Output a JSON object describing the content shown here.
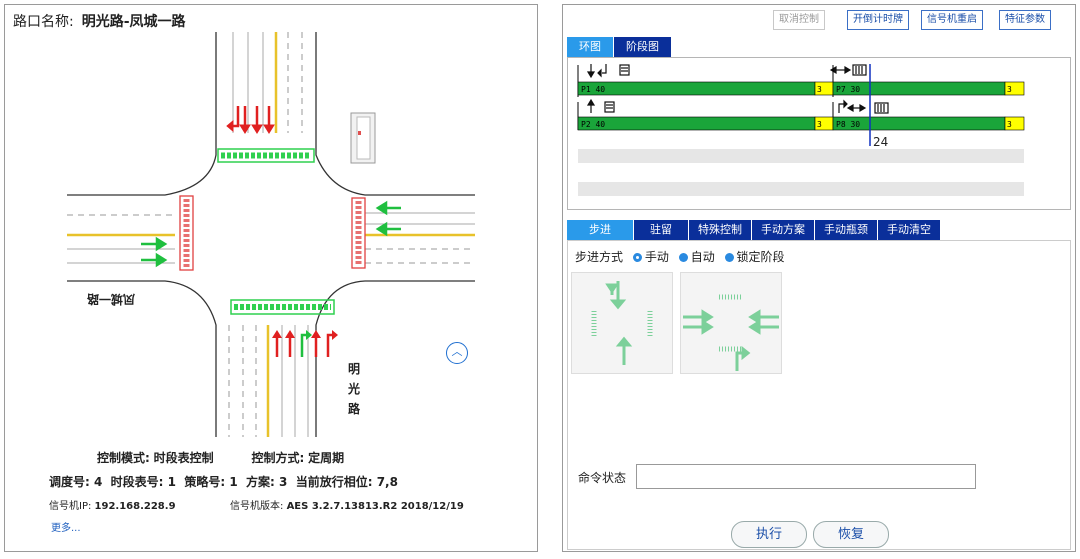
{
  "intersection": {
    "label": "路口名称:",
    "name": "明光路-凤城一路"
  },
  "roads": {
    "west": "凤城一路",
    "south": "明光路",
    "south_chars": [
      "明",
      "光",
      "路"
    ]
  },
  "status": {
    "mode_label": "控制模式:",
    "mode_value": "时段表控制",
    "method_label": "控制方式:",
    "method_value": "定周期",
    "row2": "调度号: 4  时段表号: 1  策略号: 1  方案: 3  当前放行相位: 7,8",
    "ip_label": "信号机IP:",
    "ip_value": "192.168.228.9",
    "ver_label": "信号机版本:",
    "ver_value": "AES 3.2.7.13813.R2 2018/12/19",
    "more": "更多..."
  },
  "toolbar": {
    "cancel": "取消控制",
    "timer": "开倒计时牌",
    "restart": "信号机重启",
    "params": "特征参数"
  },
  "diagram_tabs": [
    "环图",
    "阶段图"
  ],
  "ring": {
    "phases": [
      {
        "id": "P1",
        "time": "40",
        "yellow": "3"
      },
      {
        "id": "P7",
        "time": "30",
        "yellow": "3"
      },
      {
        "id": "P2",
        "time": "40",
        "yellow": "3"
      },
      {
        "id": "P8",
        "time": "30",
        "yellow": "3"
      }
    ],
    "cursor": "24"
  },
  "control_tabs": [
    "步进",
    "驻留",
    "特殊控制",
    "手动方案",
    "手动瓶颈",
    "手动清空"
  ],
  "step": {
    "label": "步进方式",
    "options": [
      "手动",
      "自动",
      "锁定阶段"
    ],
    "selected": "手动"
  },
  "command": {
    "label": "命令状态",
    "value": ""
  },
  "actions": {
    "execute": "执行",
    "restore": "恢复"
  },
  "colors": {
    "green": "#1aa53a",
    "yellow": "#ffff00",
    "tab": "#0a2f9a",
    "tab_active": "#2a9aea",
    "red_arrow": "#e02020",
    "green_arrow": "#1fbf3f"
  }
}
